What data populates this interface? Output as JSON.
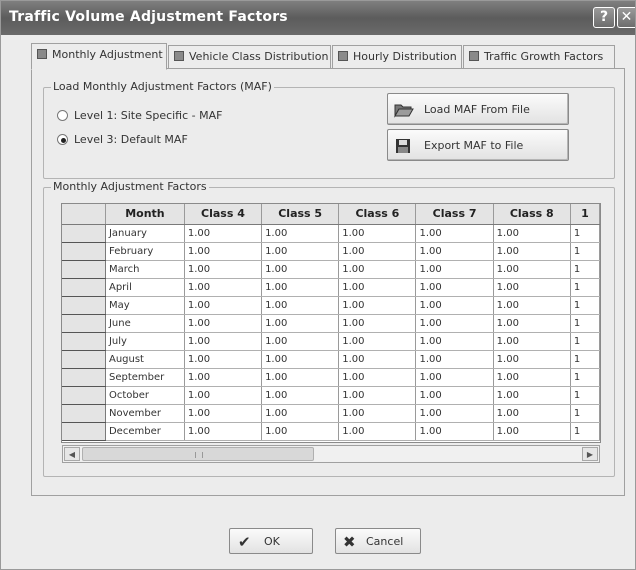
{
  "window": {
    "title": "Traffic Volume Adjustment Factors",
    "help_glyph": "?",
    "close_glyph": "✕"
  },
  "tabs": [
    {
      "label": "Monthly Adjustment"
    },
    {
      "label": "Vehicle Class Distribution"
    },
    {
      "label": "Hourly Distribution"
    },
    {
      "label": "Traffic Growth Factors"
    }
  ],
  "load_group": {
    "legend": "Load Monthly Adjustment Factors (MAF)",
    "options": [
      {
        "label": "Level 1: Site Specific - MAF",
        "selected": false
      },
      {
        "label": "Level 3: Default MAF",
        "selected": true
      }
    ],
    "load_button": "Load MAF From File",
    "export_button": "Export MAF to File"
  },
  "grid_group": {
    "legend": "Monthly Adjustment Factors"
  },
  "table": {
    "columns": [
      "Month",
      "Class 4",
      "Class 5",
      "Class 6",
      "Class 7",
      "Class 8",
      "1"
    ],
    "rows": [
      [
        "January",
        "1.00",
        "1.00",
        "1.00",
        "1.00",
        "1.00",
        "1"
      ],
      [
        "February",
        "1.00",
        "1.00",
        "1.00",
        "1.00",
        "1.00",
        "1"
      ],
      [
        "March",
        "1.00",
        "1.00",
        "1.00",
        "1.00",
        "1.00",
        "1"
      ],
      [
        "April",
        "1.00",
        "1.00",
        "1.00",
        "1.00",
        "1.00",
        "1"
      ],
      [
        "May",
        "1.00",
        "1.00",
        "1.00",
        "1.00",
        "1.00",
        "1"
      ],
      [
        "June",
        "1.00",
        "1.00",
        "1.00",
        "1.00",
        "1.00",
        "1"
      ],
      [
        "July",
        "1.00",
        "1.00",
        "1.00",
        "1.00",
        "1.00",
        "1"
      ],
      [
        "August",
        "1.00",
        "1.00",
        "1.00",
        "1.00",
        "1.00",
        "1"
      ],
      [
        "September",
        "1.00",
        "1.00",
        "1.00",
        "1.00",
        "1.00",
        "1"
      ],
      [
        "October",
        "1.00",
        "1.00",
        "1.00",
        "1.00",
        "1.00",
        "1"
      ],
      [
        "November",
        "1.00",
        "1.00",
        "1.00",
        "1.00",
        "1.00",
        "1"
      ],
      [
        "December",
        "1.00",
        "1.00",
        "1.00",
        "1.00",
        "1.00",
        "1"
      ]
    ]
  },
  "footer": {
    "ok_label": "OK",
    "cancel_label": "Cancel"
  },
  "icons": {
    "load": "folder-open-icon",
    "export": "floppy-disk-icon",
    "ok": "checkmark-icon",
    "cancel": "x-mark-icon"
  }
}
